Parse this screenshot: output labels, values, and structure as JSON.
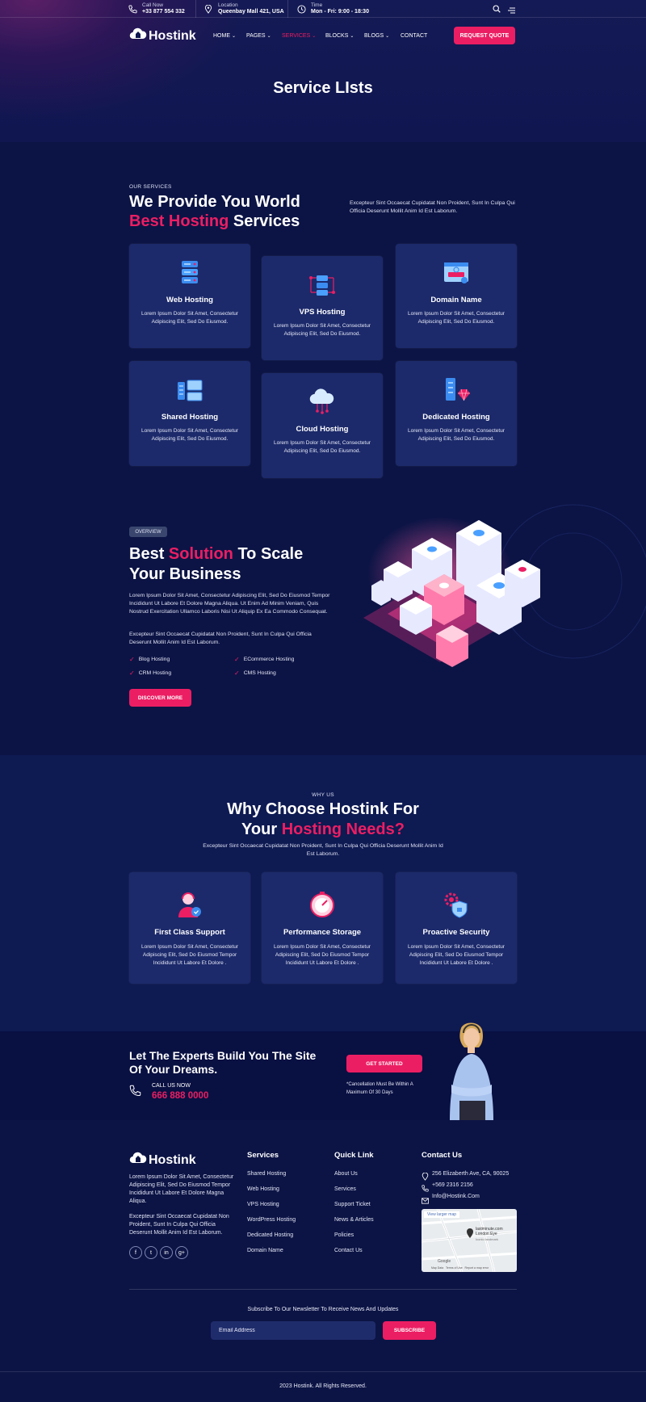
{
  "topbar": {
    "call_label": "Call Now",
    "call_value": "+33 877 554 332",
    "location_label": "Location",
    "location_value": "Queenbay Mall 421, USA",
    "time_label": "Time",
    "time_value": "Mon - Fri: 9:00 - 18:30"
  },
  "brand": {
    "name": "Hostink"
  },
  "nav": {
    "items": [
      "HOME",
      "PAGES",
      "SERVICES",
      "BLOCKS",
      "BLOGS",
      "CONTACT"
    ],
    "active": "SERVICES",
    "cta": "REQUEST QUOTE"
  },
  "hero": {
    "title": "Service LIsts"
  },
  "services": {
    "tag": "OUR SERVICES",
    "title_1": "We Provide You World",
    "title_2_accent": "Best Hosting",
    "title_2_rest": " Services",
    "intro": "Excepteur Sint Occaecat Cupidatat Non Proident, Sunt In Culpa Qui Officia Deserunt Mollit Anim Id Est Laborum.",
    "cards": [
      {
        "title": "Web Hosting",
        "desc": "Lorem Ipsum Dolor Sit Amet, Consectetur Adipiscing Elit, Sed Do Eiusmod.",
        "icon": "server-rack-icon"
      },
      {
        "title": "VPS Hosting",
        "desc": "Lorem Ipsum Dolor Sit Amet, Consectetur Adipiscing Elit, Sed Do Eiusmod.",
        "icon": "vps-server-icon"
      },
      {
        "title": "Domain Name",
        "desc": "Lorem Ipsum Dolor Sit Amet, Consectetur Adipiscing Elit, Sed Do Eiusmod.",
        "icon": "domain-browser-icon"
      },
      {
        "title": "Shared Hosting",
        "desc": "Lorem Ipsum Dolor Sit Amet, Consectetur Adipiscing Elit, Sed Do Eiusmod.",
        "icon": "shared-computers-icon"
      },
      {
        "title": "Cloud Hosting",
        "desc": "Lorem Ipsum Dolor Sit Amet, Consectetur Adipiscing Elit, Sed Do Eiusmod.",
        "icon": "cloud-network-icon"
      },
      {
        "title": "Dedicated Hosting",
        "desc": "Lorem Ipsum Dolor Sit Amet, Consectetur Adipiscing Elit, Sed Do Eiusmod.",
        "icon": "dedicated-server-gem-icon"
      }
    ]
  },
  "overview": {
    "badge": "OVERVIEW",
    "title_1": "Best ",
    "title_1_accent": "Solution",
    "title_1_rest": " To Scale",
    "title_2": "Your Business",
    "para_1": "Lorem Ipsum Dolor Sit Amet, Consectetur Adipiscing Elit, Sed Do Eiusmod Tempor Incididunt Ut Labore Et Dolore Magna Aliqua. Ut Enim Ad Minim Veniam, Quis Nostrud Exercitation Ullamco Laboris Nisi Ut Aliquip Ex Ea Commodo Consequat.",
    "para_2": "Excepteur Sint Occaecat Cupidatat Non Proident, Sunt In Culpa Qui Officia Deserunt Mollit Anim Id Est Laborum.",
    "features": [
      "Blog Hosting",
      "ECommerce Hosting",
      "CRM Hosting",
      "CMS Hosting"
    ],
    "button": "DISCOVER MORE"
  },
  "why": {
    "tag": "WHY US",
    "title_1": "Why Choose Hostink For",
    "title_2": "Your ",
    "title_2_accent": "Hosting Needs?",
    "intro": "Excepteur Sint Occaecat Cupidatat Non Proident, Sunt In Culpa Qui Officia Deserunt Mollit Anim Id Est Laborum.",
    "cards": [
      {
        "title": "First Class Support",
        "desc": "Lorem Ipsum Dolor Sit Amet, Consectetur Adipiscing Elit, Sed Do Eiusmod Tempor Incididunt Ut Labore Et Dolore .",
        "icon": "support-agent-icon"
      },
      {
        "title": "Performance Storage",
        "desc": "Lorem Ipsum Dolor Sit Amet, Consectetur Adipiscing Elit, Sed Do Eiusmod Tempor Incididunt Ut Labore Et Dolore .",
        "icon": "speed-gauge-icon"
      },
      {
        "title": "Proactive Security",
        "desc": "Lorem Ipsum Dolor Sit Amet, Consectetur Adipiscing Elit, Sed Do Eiusmod Tempor Incididunt Ut Labore Et Dolore .",
        "icon": "gear-shield-icon"
      }
    ]
  },
  "cta": {
    "title": "Let The Experts Build You The Site Of Your Dreams.",
    "call_label": "CALL US NOW",
    "phone": "666 888 0000",
    "button": "GET STARTED",
    "note": "*Cancellation Must Be Within A Maximum Of 30 Days"
  },
  "footer": {
    "about_1": "Lorem Ipsum Dolor Sit Amet, Consectetur Adipiscing Elit, Sed Do Eiusmod Tempor Incididunt Ut Labore Et Dolore Magna Aliqua.",
    "about_2": "Excepteur Sint Occaecat Cupidatat Non Proident, Sunt In Culpa Qui Officia Deserunt Mollit Anim Id Est Laborum.",
    "social": [
      "f",
      "t",
      "in",
      "g+"
    ],
    "services_title": "Services",
    "services": [
      "Shared Hosting",
      "Web Hosting",
      "VPS Hosting",
      "WordPress Hosting",
      "Dedicated Hosting",
      "Domain Name"
    ],
    "quick_title": "Quick Link",
    "quick": [
      "About Us",
      "Services",
      "Support Ticket",
      "News & Articles",
      "Policies",
      "Contact Us"
    ],
    "contact_title": "Contact Us",
    "address": "256 Elizaberth Ave, CA, 90025",
    "phone": "+569 2316 2156",
    "email": "Info@Hostink.Com",
    "map": {
      "view_larger": "View larger map",
      "place": "lastminute.com London Eye",
      "place_sub": "Iconic landmark",
      "google": "Google",
      "credits": "Map Data   Terms of Use   Report a map error"
    },
    "newsletter_text": "Subscribe To Our Newsletter To Receive News And Updates",
    "email_placeholder": "Email Address",
    "subscribe": "SUBSCRIBE",
    "copyright": "2023 Hostink. All Rights Reserved."
  },
  "colors": {
    "accent": "#ec1e63",
    "card": "#1c2a6b",
    "bg": "#0c1445"
  }
}
